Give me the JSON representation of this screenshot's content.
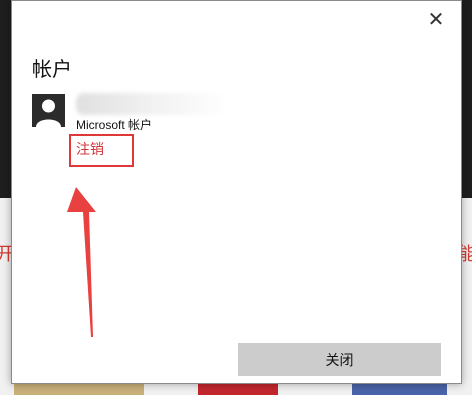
{
  "dialog": {
    "title": "帐户",
    "close_glyph": "✕",
    "account": {
      "type_label": "Microsoft 帐户",
      "sign_out_label": "注销"
    },
    "close_button_label": "关闭"
  },
  "background": {
    "left_fragment": "开",
    "right_fragment": "能"
  },
  "colors": {
    "accent_red": "#d13438",
    "annotation_red": "#e0383a",
    "button_gray": "#cccccc"
  },
  "icons": [
    "close-icon",
    "user-avatar-icon",
    "annotation-arrow"
  ]
}
